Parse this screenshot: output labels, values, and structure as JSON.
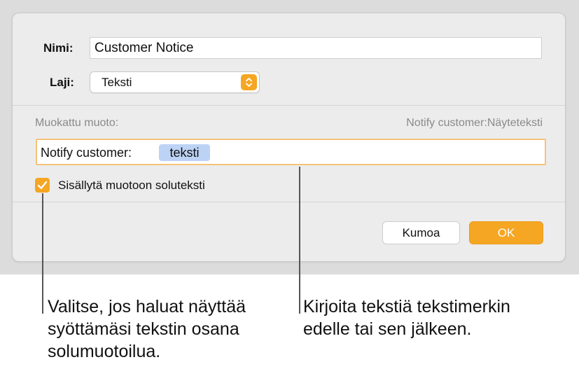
{
  "dialog": {
    "name_label": "Nimi:",
    "name_value": "Customer Notice",
    "type_label": "Laji:",
    "type_value": "Teksti",
    "custom_format_label": "Muokattu muoto:",
    "preview_text": "Notify customer:Näyteteksti",
    "format_prefix": "Notify customer:",
    "format_token": "teksti",
    "include_checkbox": {
      "label": "Sisällytä muotoon soluteksti",
      "checked": true
    },
    "cancel_label": "Kumoa",
    "ok_label": "OK"
  },
  "callouts": {
    "left": "Valitse, jos haluat näyttää\nsyöttämäsi tekstin osana\nsolumuotoilua.",
    "right": "Kirjoita tekstiä tekstimerkin\nedelle tai sen jälkeen."
  },
  "colors": {
    "accent": "#f5a623",
    "token_highlight": "#bcd3f5",
    "focus_ring": "#f5c37a"
  }
}
